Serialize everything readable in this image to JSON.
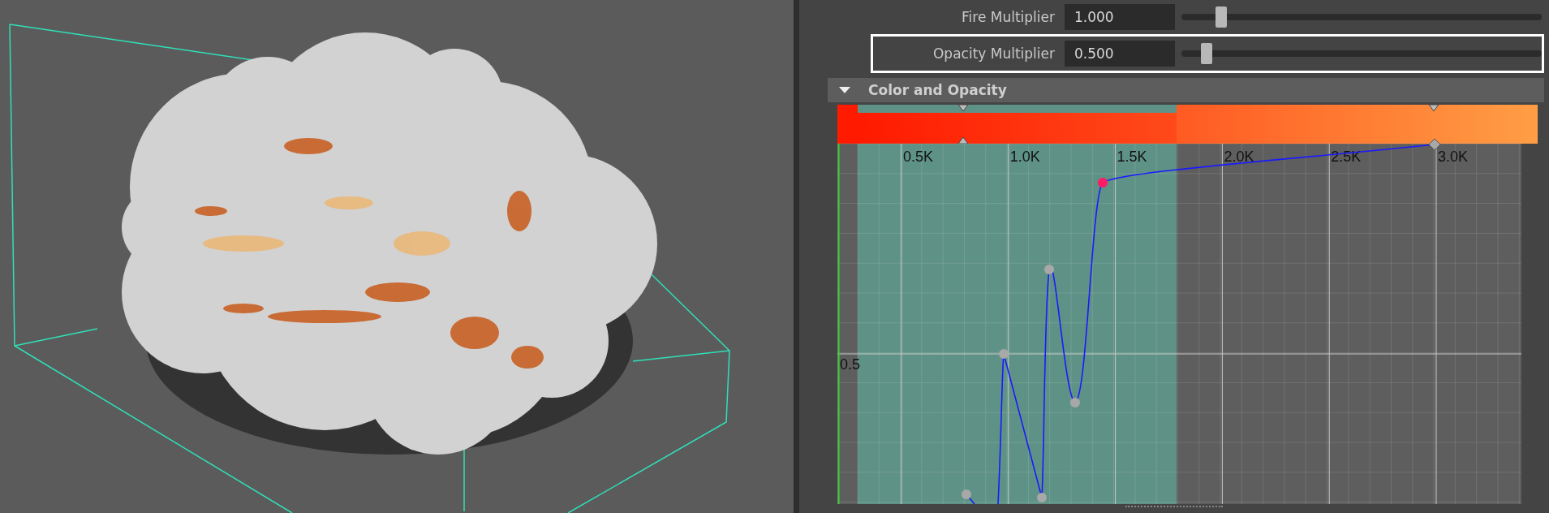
{
  "attributes": [
    {
      "label": "Fire Multiplier",
      "value": "1.000",
      "level": 0.11,
      "selected": false
    },
    {
      "label": "Opacity Multiplier",
      "value": "0.500",
      "level": 0.07,
      "selected": true
    }
  ],
  "section": {
    "title": "Color and Opacity",
    "expanded": true
  },
  "curve_editor": {
    "x_labels": [
      "0.5K",
      "1.0K",
      "1.5K",
      "2.0K",
      "2.5K",
      "3.0K"
    ],
    "y_labels": [
      "0.5"
    ]
  }
}
